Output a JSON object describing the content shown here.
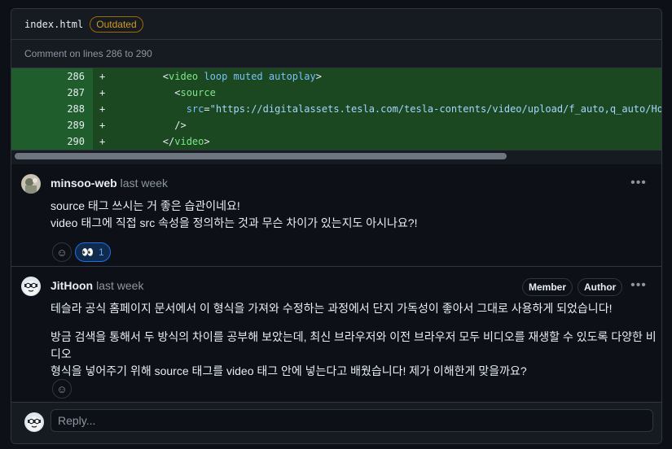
{
  "file": {
    "name": "index.html",
    "badge": "Outdated"
  },
  "comment_range": "Comment on lines 286 to 290",
  "code_lines": [
    {
      "num": "286",
      "sign": "+",
      "indent": "        ",
      "parts": [
        [
          "punc",
          "<"
        ],
        [
          "tag",
          "video"
        ],
        [
          "punc",
          " "
        ],
        [
          "attr",
          "loop"
        ],
        [
          "punc",
          " "
        ],
        [
          "attr",
          "muted"
        ],
        [
          "punc",
          " "
        ],
        [
          "attr",
          "autoplay"
        ],
        [
          "punc",
          ">"
        ]
      ]
    },
    {
      "num": "287",
      "sign": "+",
      "indent": "          ",
      "parts": [
        [
          "punc",
          "<"
        ],
        [
          "tag",
          "source"
        ]
      ]
    },
    {
      "num": "288",
      "sign": "+",
      "indent": "            ",
      "parts": [
        [
          "attr",
          "src"
        ],
        [
          "punc",
          "="
        ],
        [
          "str",
          "\"https://digitalassets.tesla.com/tesla-contents/video/upload/f_auto,q_auto/Hom"
        ]
      ]
    },
    {
      "num": "289",
      "sign": "+",
      "indent": "          ",
      "parts": [
        [
          "punc",
          "/>"
        ]
      ]
    },
    {
      "num": "290",
      "sign": "+",
      "indent": "        ",
      "parts": [
        [
          "punc",
          "</"
        ],
        [
          "tag",
          "video"
        ],
        [
          "punc",
          ">"
        ]
      ]
    }
  ],
  "comments": [
    {
      "author": "minsoo-web",
      "time": "last week",
      "lines": [
        "source 태그 쓰시는 거 좋은 습관이네요!",
        "video 태그에 직접 src 속성을 정의하는 것과 무슨 차이가 있는지도 아시나요?!"
      ],
      "reaction": {
        "emoji": "👀",
        "count": "1"
      }
    },
    {
      "author": "JitHoon",
      "time": "last week",
      "badges": [
        "Member",
        "Author"
      ],
      "paragraphs": [
        "테슬라 공식 홈페이지 문서에서 이 형식을 가져와 수정하는 과정에서 단지 가독성이 좋아서 그대로 사용하게 되었습니다!",
        "방금 검색을 통해서 두 방식의 차이를 공부해 보았는데, 최신 브라우저와 이전 브라우저 모두 비디오를 재생할 수 있도록 다양한 비디오",
        "형식을 넣어주기 위해 source 태그를 video 태그 안에 넣는다고 배웠습니다! 제가 이해한게 맞을까요?"
      ]
    }
  ],
  "reply": {
    "placeholder": "Reply..."
  },
  "icons": {
    "more": "kebab-horizontal-icon",
    "smiley": "smiley-icon"
  },
  "colors": {
    "accent": "#58a6ff",
    "added_bg": "#1b4721",
    "outdated": "#d29922"
  }
}
